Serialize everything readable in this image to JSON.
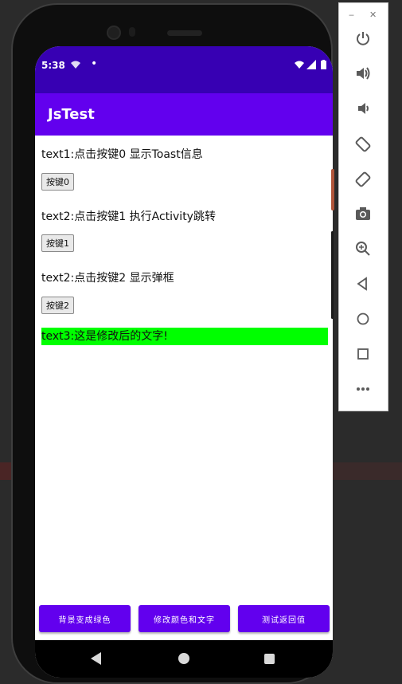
{
  "status_bar": {
    "time": "5:38"
  },
  "app_bar": {
    "title": "JsTest"
  },
  "main": {
    "text1": "text1:点击按键0 显示Toast信息",
    "button0": "按键0",
    "text2a": "text2:点击按键1 执行Activity跳转",
    "button1": "按键1",
    "text2b": "text2:点击按键2 显示弹框",
    "button2": "按键2",
    "text3": "text3:这是修改后的文字!"
  },
  "bottom_buttons": [
    {
      "label": "背景变成绿色"
    },
    {
      "label": "修改颜色和文字"
    },
    {
      "label": "测试返回值"
    }
  ],
  "colors": {
    "status_bar": "#3700b3",
    "app_bar": "#6200ee",
    "highlight": "#00ff00"
  },
  "emulator_toolbar": {
    "icons": [
      "minimize-icon",
      "close-icon",
      "power-icon",
      "volume-up-icon",
      "volume-down-icon",
      "rotate-left-icon",
      "rotate-right-icon",
      "camera-icon",
      "zoom-icon",
      "back-icon",
      "home-icon",
      "overview-icon",
      "more-icon"
    ]
  }
}
